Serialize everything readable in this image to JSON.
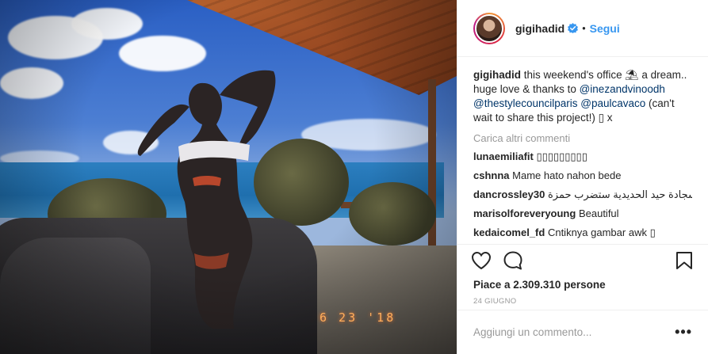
{
  "post": {
    "image_alt": "",
    "date_stamp": "6 23 '18"
  },
  "header": {
    "username": "gigihadid",
    "separator": "•",
    "follow_label": "Segui"
  },
  "caption": {
    "username": "gigihadid",
    "text_1": "this weekend's office ",
    "glyph": "⛱",
    "text_2": " a dream.. huge love & thanks to ",
    "mention_1": "@inezandvinoodh",
    "mention_2": "@thestylecouncilparis",
    "mention_3": "@paulcavaco",
    "text_3": " (can't wait to share this project!) ",
    "text_4": "▯ x"
  },
  "load_more": "Carica altri commenti",
  "comments": [
    {
      "username": "lunaemiliafit",
      "text": "▯▯▯▯▯▯▯▯▯"
    },
    {
      "username": "cshnna",
      "text": "Mame hato nahon bede"
    },
    {
      "username": "dancrossley30",
      "text": "سجادة حيد الحديدية ستضرب حمزة."
    },
    {
      "username": "marisolforeveryoung",
      "text": "Beautiful"
    },
    {
      "username": "kedaicomel_fd",
      "text": "Cntiknya gambar awk ▯"
    }
  ],
  "likes": "Piace a 2.309.310 persone",
  "date": "24 GIUGNO",
  "add_comment_placeholder": "Aggiungi un commento...",
  "more_label": "•••",
  "icons": {
    "like": "heart-icon",
    "comment": "speech-bubble-icon",
    "save": "bookmark-icon",
    "verified": "verified-badge-icon"
  },
  "colors": {
    "link": "#3897f0",
    "mention": "#003569",
    "muted": "#999999"
  }
}
